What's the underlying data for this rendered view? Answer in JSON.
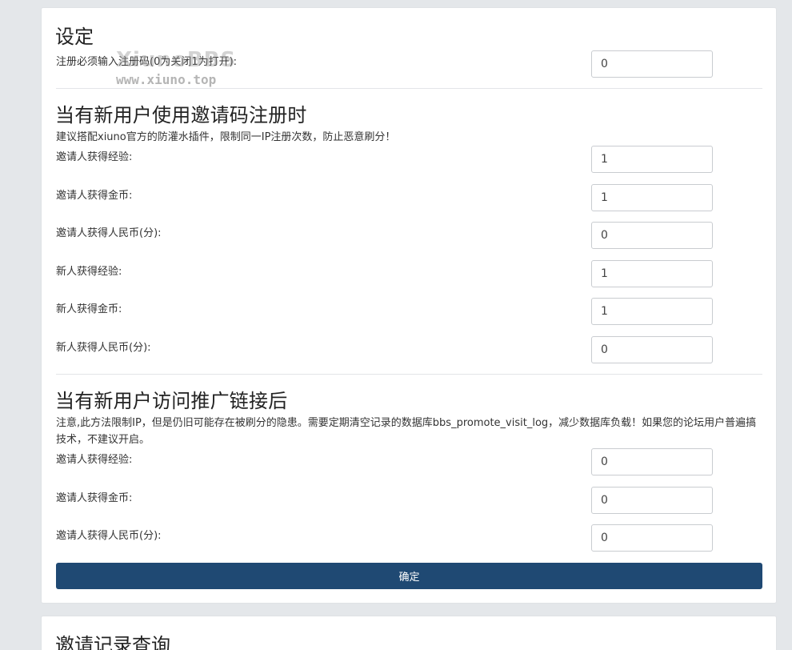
{
  "settings": {
    "title": "设定",
    "register_code_label": "注册必须输入注册码(0为关闭1为打开):",
    "register_code_value": "0"
  },
  "watermark": {
    "logo": "XiunoBBS",
    "url": "www.xiuno.top"
  },
  "invite_register": {
    "title": "当有新用户使用邀请码注册时",
    "note": "建议搭配xiuno官方的防灌水插件，限制同一IP注册次数，防止恶意刷分！",
    "fields": [
      {
        "label": "邀请人获得经验:",
        "value": "1"
      },
      {
        "label": "邀请人获得金币:",
        "value": "1"
      },
      {
        "label": "邀请人获得人民币(分):",
        "value": "0"
      },
      {
        "label": "新人获得经验:",
        "value": "1"
      },
      {
        "label": "新人获得金币:",
        "value": "1"
      },
      {
        "label": "新人获得人民币(分):",
        "value": "0"
      }
    ]
  },
  "promote_visit": {
    "title": "当有新用户访问推广链接后",
    "note": "注意,此方法限制IP，但是仍旧可能存在被刷分的隐患。需要定期清空记录的数据库bbs_promote_visit_log，减少数据库负载！如果您的论坛用户普遍搞技术，不建议开启。",
    "fields": [
      {
        "label": "邀请人获得经验:",
        "value": "0"
      },
      {
        "label": "邀请人获得金币:",
        "value": "0"
      },
      {
        "label": "邀请人获得人民币(分):",
        "value": "0"
      }
    ]
  },
  "submit_label": "确定",
  "records": {
    "title": "邀请记录查询"
  }
}
